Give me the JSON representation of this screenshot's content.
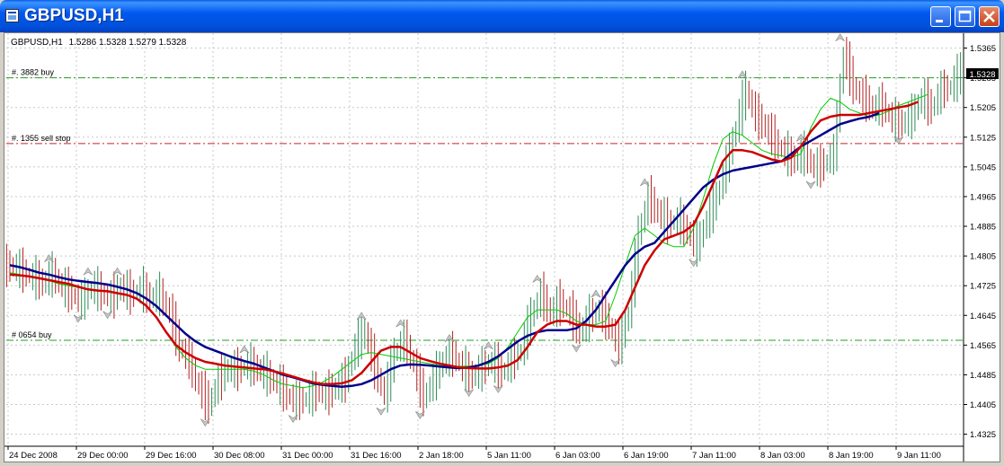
{
  "window": {
    "title": "GBPUSD,H1",
    "buttons": [
      "minimize",
      "maximize",
      "close"
    ]
  },
  "chart_header": {
    "symbol": "GBPUSD,H1",
    "ohlc": "1.5286 1.5328 1.5279 1.5328"
  },
  "current_price": "1.5328",
  "colors": {
    "background": "#ffffff",
    "grid": "#c8c8c8",
    "bull_bar": "#2e8b57",
    "bear_bar": "#b22222",
    "ma_fast": "#00cc00",
    "ma_mid": "#cc0000",
    "ma_slow": "#00008b",
    "buy_line": "#22a022",
    "sell_line": "#cc2222",
    "price_label_bg": "#000000"
  },
  "chart_data": {
    "type": "line",
    "ylim": [
      1.4295,
      1.5405
    ],
    "y_ticks": [
      "1.5365",
      "1.5285",
      "1.5205",
      "1.5125",
      "1.5045",
      "1.4965",
      "1.4885",
      "1.4805",
      "1.4725",
      "1.4645",
      "1.4565",
      "1.4485",
      "1.4405",
      "1.4325"
    ],
    "x_ticks": [
      "24 Dec 2008",
      "29 Dec 00:00",
      "29 Dec 16:00",
      "30 Dec 08:00",
      "31 Dec 00:00",
      "31 Dec 16:00",
      "2 Jan 18:00",
      "5 Jan 11:00",
      "6 Jan 03:00",
      "6 Jan 19:00",
      "7 Jan 11:00",
      "8 Jan 03:00",
      "8 Jan 19:00",
      "9 Jan 11:00"
    ],
    "grid": true,
    "levels": [
      {
        "label": "#.    3882 buy",
        "price": 1.5285,
        "kind": "buy"
      },
      {
        "label": "#.    1355 sell stop",
        "price": 1.5108,
        "kind": "sell"
      },
      {
        "label": "#      0654 buy",
        "price": 1.4578,
        "kind": "buy"
      }
    ],
    "series": [
      {
        "key": "close",
        "values": [
          1.4775,
          1.476,
          1.4745,
          1.473,
          1.4755,
          1.472,
          1.47,
          1.468,
          1.472,
          1.4705,
          1.469,
          1.472,
          1.47,
          1.4715,
          1.469,
          1.47,
          1.465,
          1.456,
          1.452,
          1.445,
          1.44,
          1.447,
          1.45,
          1.4495,
          1.451,
          1.45,
          1.448,
          1.446,
          1.443,
          1.441,
          1.442,
          1.444,
          1.443,
          1.445,
          1.447,
          1.456,
          1.46,
          1.45,
          1.443,
          1.454,
          1.458,
          1.451,
          1.442,
          1.447,
          1.452,
          1.454,
          1.45,
          1.448,
          1.45,
          1.452,
          1.449,
          1.452,
          1.455,
          1.464,
          1.47,
          1.465,
          1.468,
          1.465,
          1.46,
          1.464,
          1.466,
          1.462,
          1.456,
          1.465,
          1.486,
          1.496,
          1.492,
          1.489,
          1.49,
          1.487,
          1.483,
          1.49,
          1.496,
          1.505,
          1.515,
          1.525,
          1.518,
          1.515,
          1.511,
          1.508,
          1.506,
          1.508,
          1.504,
          1.505,
          1.508,
          1.535,
          1.526,
          1.523,
          1.52,
          1.521,
          1.517,
          1.516,
          1.518,
          1.523,
          1.52,
          1.525,
          1.526,
          1.53
        ]
      },
      {
        "key": "ma_fast",
        "values": [
          1.476,
          1.4755,
          1.475,
          1.4745,
          1.474,
          1.473,
          1.4725,
          1.472,
          1.4715,
          1.4712,
          1.471,
          1.4705,
          1.47,
          1.469,
          1.467,
          1.464,
          1.46,
          1.456,
          1.453,
          1.451,
          1.45,
          1.45,
          1.45,
          1.45,
          1.45,
          1.4495,
          1.4485,
          1.447,
          1.446,
          1.4455,
          1.445,
          1.4455,
          1.4465,
          1.448,
          1.45,
          1.452,
          1.454,
          1.4545,
          1.454,
          1.4535,
          1.453,
          1.4525,
          1.452,
          1.4515,
          1.451,
          1.4508,
          1.4508,
          1.4508,
          1.451,
          1.4515,
          1.453,
          1.456,
          1.46,
          1.464,
          1.466,
          1.466,
          1.466,
          1.465,
          1.463,
          1.462,
          1.462,
          1.463,
          1.47,
          1.478,
          1.486,
          1.488,
          1.486,
          1.484,
          1.483,
          1.483,
          1.488,
          1.496,
          1.505,
          1.512,
          1.514,
          1.513,
          1.511,
          1.509,
          1.508,
          1.5075,
          1.507,
          1.508,
          1.515,
          1.52,
          1.523,
          1.522,
          1.52,
          1.519,
          1.518,
          1.5185,
          1.5195,
          1.521,
          1.522,
          1.523,
          1.524
        ]
      },
      {
        "key": "ma_mid",
        "values": [
          1.4755,
          1.4753,
          1.475,
          1.4745,
          1.474,
          1.4735,
          1.473,
          1.4722,
          1.4715,
          1.4712,
          1.471,
          1.4705,
          1.47,
          1.469,
          1.467,
          1.464,
          1.46,
          1.4565,
          1.4545,
          1.453,
          1.452,
          1.4515,
          1.451,
          1.4507,
          1.4505,
          1.4502,
          1.45,
          1.4495,
          1.4488,
          1.448,
          1.4472,
          1.4465,
          1.446,
          1.446,
          1.4462,
          1.447,
          1.449,
          1.452,
          1.455,
          1.456,
          1.456,
          1.4545,
          1.453,
          1.4522,
          1.4515,
          1.451,
          1.4505,
          1.4503,
          1.4502,
          1.4502,
          1.4505,
          1.451,
          1.4525,
          1.456,
          1.46,
          1.462,
          1.463,
          1.463,
          1.462,
          1.462,
          1.4615,
          1.4615,
          1.462,
          1.466,
          1.472,
          1.478,
          1.482,
          1.485,
          1.486,
          1.487,
          1.489,
          1.494,
          1.5,
          1.506,
          1.509,
          1.509,
          1.5085,
          1.5075,
          1.5065,
          1.506,
          1.507,
          1.51,
          1.514,
          1.517,
          1.518,
          1.5185,
          1.5185,
          1.5185,
          1.519,
          1.5195,
          1.52,
          1.5205,
          1.521,
          1.522
        ]
      },
      {
        "key": "ma_slow",
        "values": [
          1.478,
          1.4775,
          1.4768,
          1.476,
          1.4755,
          1.4748,
          1.4742,
          1.4738,
          1.4735,
          1.4732,
          1.4728,
          1.4722,
          1.4715,
          1.4705,
          1.469,
          1.467,
          1.4645,
          1.462,
          1.4595,
          1.4575,
          1.456,
          1.455,
          1.454,
          1.453,
          1.4522,
          1.4515,
          1.4505,
          1.4495,
          1.4485,
          1.4478,
          1.447,
          1.4462,
          1.4458,
          1.4455,
          1.4453,
          1.4455,
          1.446,
          1.447,
          1.4485,
          1.45,
          1.451,
          1.4513,
          1.4512,
          1.451,
          1.4507,
          1.4505,
          1.4503,
          1.4505,
          1.451,
          1.452,
          1.4535,
          1.4555,
          1.4575,
          1.459,
          1.46,
          1.4605,
          1.4605,
          1.4605,
          1.461,
          1.463,
          1.466,
          1.47,
          1.474,
          1.478,
          1.481,
          1.483,
          1.484,
          1.487,
          1.49,
          1.493,
          1.496,
          1.499,
          1.501,
          1.5025,
          1.5035,
          1.504,
          1.5045,
          1.505,
          1.5055,
          1.506,
          1.508,
          1.51,
          1.5115,
          1.513,
          1.5145,
          1.516,
          1.5168,
          1.5175,
          1.518,
          1.519
        ]
      }
    ]
  }
}
